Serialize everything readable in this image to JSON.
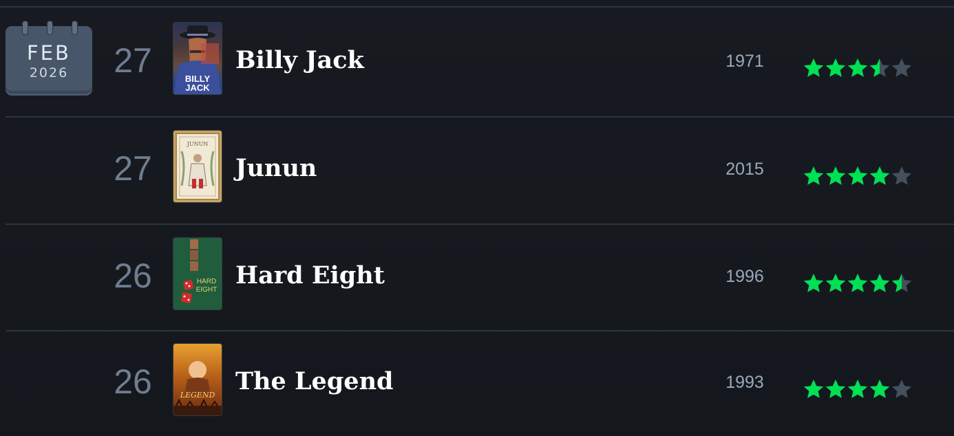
{
  "calendar": {
    "month": "FEB",
    "year": "2026"
  },
  "colors": {
    "star_filled": "#00e054",
    "star_empty": "#45505d"
  },
  "entries": [
    {
      "day": "27",
      "title": "Billy Jack",
      "year": "1971",
      "rating": 3.5,
      "poster_icon": "billy-jack-poster",
      "poster_text": [
        "BILLY",
        "JACK"
      ]
    },
    {
      "day": "27",
      "title": "Junun",
      "year": "2015",
      "rating": 4,
      "poster_icon": "junun-poster",
      "poster_text": [
        "JUNUN"
      ]
    },
    {
      "day": "26",
      "title": "Hard Eight",
      "year": "1996",
      "rating": 4.5,
      "poster_icon": "hard-eight-poster",
      "poster_text": [
        "HARD",
        "EIGHT"
      ]
    },
    {
      "day": "26",
      "title": "The Legend",
      "year": "1993",
      "rating": 4,
      "poster_icon": "the-legend-poster",
      "poster_text": [
        "LEGEND"
      ]
    }
  ]
}
